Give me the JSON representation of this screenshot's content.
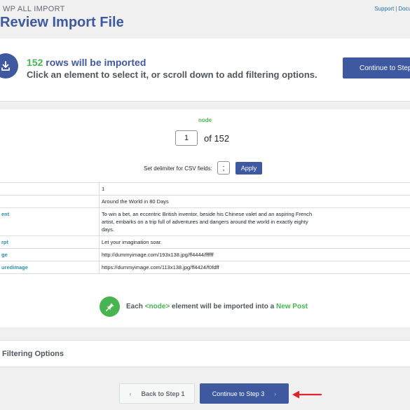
{
  "header": {
    "brand": "WP ALL IMPORT",
    "title": "Review Import File",
    "support_link": "Support",
    "separator": "|",
    "docs_link": "Docu"
  },
  "summary": {
    "row_count": "152",
    "rows_text": " rows will be imported",
    "instruction": "Click an element to select it, or scroll down to add filtering options.",
    "continue_label": "Continue to Step"
  },
  "navigator": {
    "node_label": "node",
    "current_page": "1",
    "of_text": "of 152"
  },
  "delimiter": {
    "label": "Set delimiter for CSV fields:",
    "value": ";",
    "apply_label": "Apply"
  },
  "table": {
    "rows": [
      {
        "key": "",
        "value": "1"
      },
      {
        "key": "",
        "value": "Around the World in 80 Days"
      },
      {
        "key": "ent",
        "value": "To win a bet, an eccentric British inventor, beside his Chinese valet and an aspiring French artist, embarks on a trip full of adventures and dangers around the world in exactly eighty days."
      },
      {
        "key": "rpt",
        "value": "Let your imagination soar."
      },
      {
        "key": "ge",
        "value": "http://dummyimage.com/193x138.jpg/ff4444/ffffff"
      },
      {
        "key": "uredimage",
        "value": "https://dummyimage.com/113x138.jpg/ff4424/f0fdff"
      }
    ]
  },
  "import_note": {
    "prefix": "Each ",
    "node_tag": "<node>",
    "middle": " element will be imported into a ",
    "target": "New Post"
  },
  "filtering": {
    "title": "Filtering Options"
  },
  "footer": {
    "back_label": "Back to Step 1",
    "next_label": "Continue to Step 3"
  },
  "colors": {
    "accent_blue": "#3f59a0",
    "accent_green": "#46b450",
    "arrow_red": "#e02424"
  },
  "icons": {
    "upload": "upload-icon",
    "pin": "pin-icon",
    "back": "chevron-left-icon",
    "next": "chevron-right-icon",
    "annotation": "red-arrow-icon"
  }
}
